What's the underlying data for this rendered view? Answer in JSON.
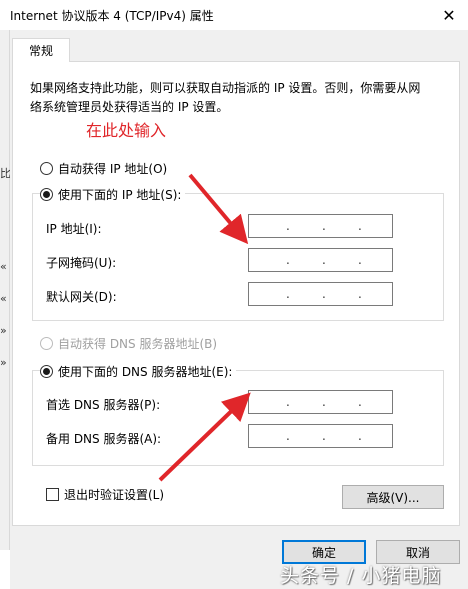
{
  "window": {
    "title": "Internet 协议版本 4 (TCP/IPv4) 属性",
    "close_glyph": "✕"
  },
  "background_window": {
    "glyphs": [
      "比",
      "«",
      "«",
      "»",
      "»"
    ]
  },
  "tab": {
    "label": "常规"
  },
  "description": "如果网络支持此功能，则可以获取自动指派的 IP 设置。否则，你需要从网络系统管理员处获得适当的 IP 设置。",
  "annotation": "在此处输入",
  "ip_section": {
    "auto_label": "自动获得 IP 地址(O)",
    "auto_selected": false,
    "manual_label": "使用下面的 IP 地址(S):",
    "manual_selected": true,
    "fields": [
      {
        "label": "IP 地址(I):",
        "value": ".  .  ."
      },
      {
        "label": "子网掩码(U):",
        "value": ".  .  ."
      },
      {
        "label": "默认网关(D):",
        "value": ".  .  ."
      }
    ]
  },
  "dns_section": {
    "auto_label": "自动获得 DNS 服务器地址(B)",
    "auto_enabled": false,
    "manual_label": "使用下面的 DNS 服务器地址(E):",
    "manual_selected": true,
    "fields": [
      {
        "label": "首选 DNS 服务器(P):",
        "value": ".  .  ."
      },
      {
        "label": "备用 DNS 服务器(A):",
        "value": ".  .  ."
      }
    ]
  },
  "validate_on_exit": {
    "label": "退出时验证设置(L)",
    "checked": false
  },
  "buttons": {
    "advanced": "高级(V)...",
    "ok": "确定",
    "cancel": "取消"
  },
  "watermark": "头条号 / 小猪电脑",
  "colors": {
    "annotation": "#e0262a",
    "default_button_border": "#0078d7",
    "dialog_bg": "#f0f0f0"
  }
}
